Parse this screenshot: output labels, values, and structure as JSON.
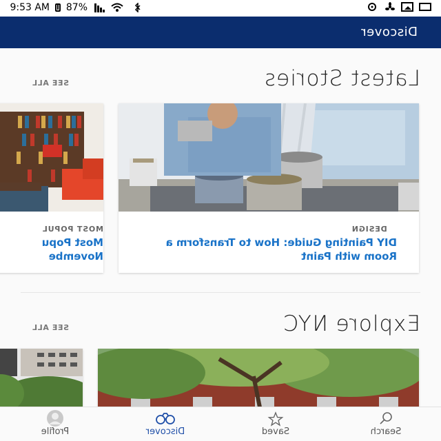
{
  "status_bar": {
    "time": "9:53 AM",
    "battery": "87%"
  },
  "app_bar": {
    "title": "Discover"
  },
  "latest": {
    "title": "Latest Stories",
    "see_all": "SEE ALL",
    "cards": [
      {
        "category": "DESIGN",
        "headline": "DIY Painting Guide: How to Transform a Room with Paint"
      },
      {
        "category": "MOST POPUL",
        "headline": "Most Popu Novembe"
      }
    ]
  },
  "explore": {
    "title": "Explore NYC",
    "see_all": "SEE ALL"
  },
  "nav": {
    "items": [
      {
        "label": "Search",
        "icon": "search-icon"
      },
      {
        "label": "Saved",
        "icon": "star-icon"
      },
      {
        "label": "Discover",
        "icon": "binoculars-icon"
      },
      {
        "label": "Profile",
        "icon": "person-icon"
      }
    ]
  },
  "colors": {
    "app_bar": "#0b2d6e",
    "link": "#1a73c8",
    "active_nav": "#1f4fa8"
  }
}
